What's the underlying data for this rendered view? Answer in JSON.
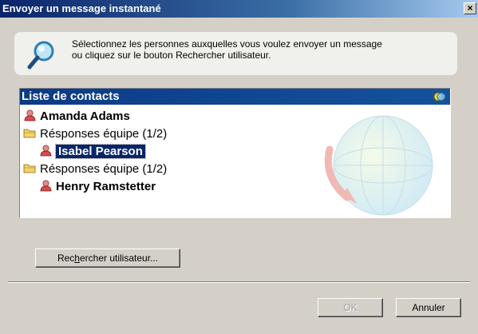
{
  "window": {
    "title": "Envoyer un message instantané",
    "close_glyph": "×"
  },
  "info": {
    "icon": "magnifier-icon",
    "line1": "Sélectionnez les personnes auxquelles vous voulez envoyer un message",
    "line2": "ou cliquez sur le bouton Rechercher utilisateur."
  },
  "contacts": {
    "header": "Liste de contacts",
    "rows": [
      {
        "type": "contact",
        "name": "Amanda Adams",
        "icon": "user-icon",
        "selected": false
      },
      {
        "type": "group",
        "name": "Résponses équipe (1/2)",
        "icon": "folder-icon"
      },
      {
        "type": "contact",
        "name": "Isabel Pearson",
        "icon": "user-icon",
        "selected": true
      },
      {
        "type": "group",
        "name": "Résponses équipe (1/2)",
        "icon": "folder-icon"
      },
      {
        "type": "contact",
        "name": "Henry Ramstetter",
        "icon": "user-icon",
        "selected": false
      }
    ]
  },
  "buttons": {
    "search_prefix": "Rec",
    "search_accel": "h",
    "search_suffix": "ercher utilisateur...",
    "ok": "OK",
    "cancel": "Annuler"
  },
  "colors": {
    "title_bar": "#0a246a",
    "contacts_header": "#0b3a86",
    "selection": "#0a246a",
    "window_bg": "#d4d0c8"
  }
}
